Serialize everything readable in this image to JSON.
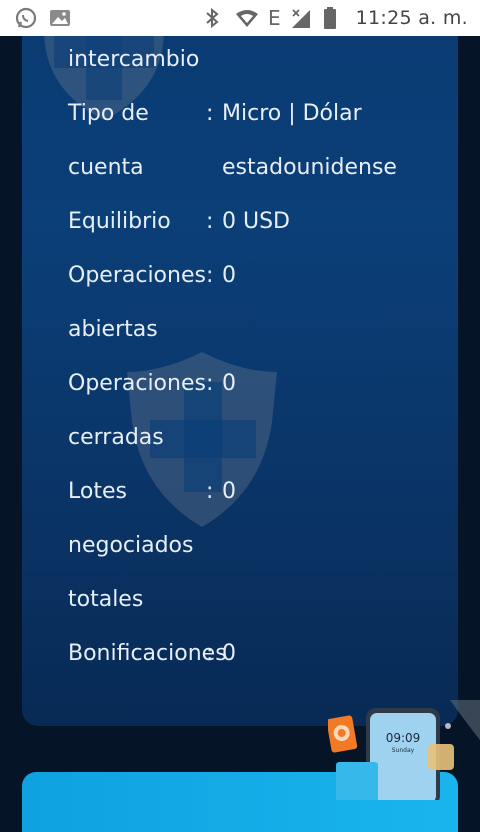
{
  "status_bar": {
    "time": "11:25 a. m.",
    "network_label": "E",
    "left_icons": [
      "whatsapp-icon",
      "gallery-icon"
    ],
    "right_icons": [
      "bluetooth-icon",
      "wifi-icon",
      "signal-icon",
      "battery-icon"
    ]
  },
  "account": {
    "rows": [
      {
        "label_lines": [
          "intercambio"
        ],
        "colon": "",
        "value_lines": []
      },
      {
        "label_lines": [
          "Tipo de",
          "cuenta"
        ],
        "colon": ":",
        "value_lines": [
          "Micro  |  Dólar",
          "estadounidense"
        ]
      },
      {
        "label_lines": [
          "Equilibrio"
        ],
        "colon": ":",
        "value_lines": [
          "0 USD"
        ]
      },
      {
        "label_lines": [
          "Operaciones",
          "abiertas"
        ],
        "colon": ":",
        "value_lines": [
          "0"
        ]
      },
      {
        "label_lines": [
          "Operaciones",
          "cerradas"
        ],
        "colon": ":",
        "value_lines": [
          "0"
        ]
      },
      {
        "label_lines": [
          "Lotes",
          "negociados",
          "totales"
        ],
        "colon": ":",
        "value_lines": [
          "0"
        ]
      },
      {
        "label_lines": [
          "Bonificaciones"
        ],
        "colon": ":",
        "value_lines": [
          "0"
        ]
      }
    ]
  },
  "promo": {
    "phone_time": "09:09",
    "phone_day": "Sunday"
  },
  "colors": {
    "panel_top": "#0a3a72",
    "panel_bottom": "#082a55",
    "text": "#e8eef6",
    "cta": "#19b5ee",
    "background": "#061427"
  }
}
